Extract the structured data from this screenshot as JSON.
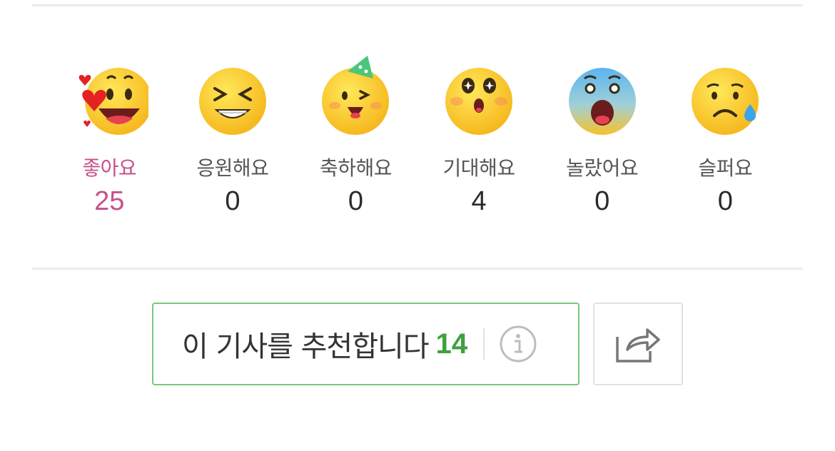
{
  "reactions": [
    {
      "label": "좋아요",
      "count": "25",
      "active": true,
      "icon": "heart-eyes-laugh-emoji"
    },
    {
      "label": "응원해요",
      "count": "0",
      "active": false,
      "icon": "cheer-grin-emoji"
    },
    {
      "label": "축하해요",
      "count": "0",
      "active": false,
      "icon": "party-hat-emoji"
    },
    {
      "label": "기대해요",
      "count": "4",
      "active": false,
      "icon": "sparkle-eyes-emoji"
    },
    {
      "label": "놀랐어요",
      "count": "0",
      "active": false,
      "icon": "shocked-emoji"
    },
    {
      "label": "슬퍼요",
      "count": "0",
      "active": false,
      "icon": "sad-tear-emoji"
    }
  ],
  "recommend": {
    "text": "이 기사를 추천합니다",
    "count": "14"
  },
  "colors": {
    "active": "#c6508c",
    "recommend_border": "#76c97d",
    "recommend_count": "#3ea13f"
  }
}
